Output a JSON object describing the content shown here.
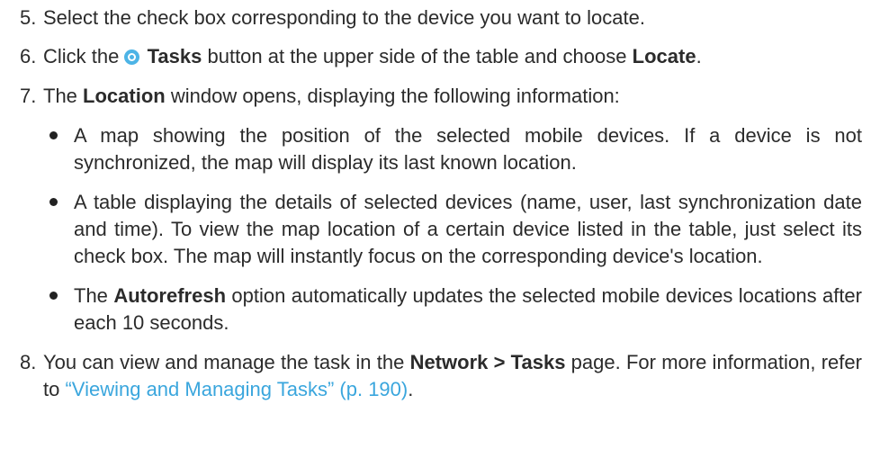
{
  "steps": {
    "s5": {
      "num": "5.",
      "text": "Select the check box corresponding to the device you want to locate."
    },
    "s6": {
      "num": "6.",
      "pre": "Click the",
      "tasks": "Tasks",
      "mid": "button at the upper side of the table and choose",
      "locate": "Locate",
      "end": "."
    },
    "s7": {
      "num": "7.",
      "pre": "The",
      "location": "Location",
      "post": "window opens, displaying the following information:"
    },
    "bullets": {
      "b1": "A map showing the position of the selected mobile devices. If a device is not synchronized, the map will display its last known location.",
      "b2": "A table displaying the details of selected devices (name, user, last synchronization date and time). To view the map location of a certain device listed in the table, just select its check box. The map will instantly focus on the corresponding device's location.",
      "b3_pre": "The",
      "b3_bold": "Autorefresh",
      "b3_post": "option automatically updates the selected mobile devices locations after each 10 seconds."
    },
    "s8": {
      "num": "8.",
      "pre": "You can view and manage the task in the",
      "bold": "Network > Tasks",
      "mid": "page. For more information, refer to",
      "link": "“Viewing and Managing Tasks” (p. 190)",
      "end": "."
    }
  },
  "icons": {
    "tasks": "tasks-icon"
  },
  "colors": {
    "link": "#3aa6dd",
    "icon": "#4db4e6"
  }
}
